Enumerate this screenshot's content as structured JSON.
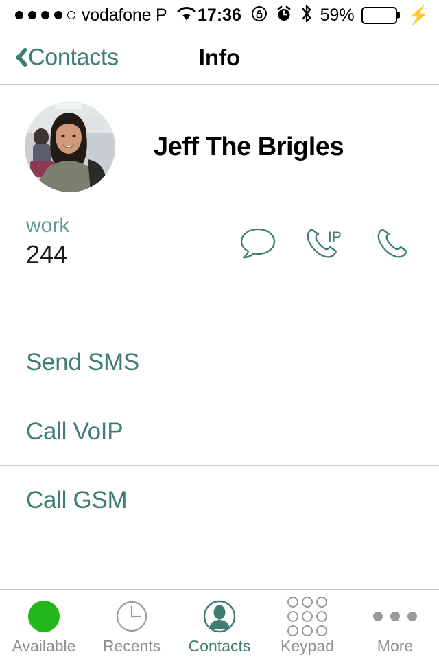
{
  "status_bar": {
    "signal_dots_filled": 4,
    "signal_dots_total": 5,
    "carrier": "vodafone P",
    "wifi_icon": "wifi-icon",
    "time": "17:36",
    "rotation_lock_icon": "rotation-lock-icon",
    "alarm_icon": "alarm-clock-icon",
    "bluetooth_icon": "bluetooth-icon",
    "battery_percent": "59%",
    "battery_level": 59,
    "battery_color": "#33d447",
    "charging_icon": "lightning-bolt-icon"
  },
  "nav": {
    "back_label": "Contacts",
    "back_icon": "chevron-left-icon",
    "title": "Info"
  },
  "contact": {
    "name": "Jeff The Brigles",
    "avatar": "contact-photo"
  },
  "phone_field": {
    "label": "work",
    "value": "244",
    "actions": [
      {
        "icon": "message-bubble-icon",
        "name": "send-message-action"
      },
      {
        "icon": "phone-ip-icon",
        "name": "call-voip-action"
      },
      {
        "icon": "phone-handset-icon",
        "name": "call-phone-action"
      }
    ]
  },
  "actions": [
    {
      "label": "Send SMS",
      "name": "send-sms"
    },
    {
      "label": "Call VoIP",
      "name": "call-voip"
    },
    {
      "label": "Call GSM",
      "name": "call-gsm"
    }
  ],
  "tabbar": {
    "active_index": 2,
    "items": [
      {
        "label": "Available",
        "icon": "availability-status-icon"
      },
      {
        "label": "Recents",
        "icon": "clock-icon"
      },
      {
        "label": "Contacts",
        "icon": "person-circle-icon"
      },
      {
        "label": "Keypad",
        "icon": "keypad-grid-icon"
      },
      {
        "label": "More",
        "icon": "ellipsis-icon"
      }
    ]
  },
  "colors": {
    "accent_teal": "#3d7d72",
    "label_teal": "#5f9a92",
    "inactive_gray": "#8e8e93",
    "separator": "#cfcfcf",
    "available_green": "#22b81c"
  }
}
